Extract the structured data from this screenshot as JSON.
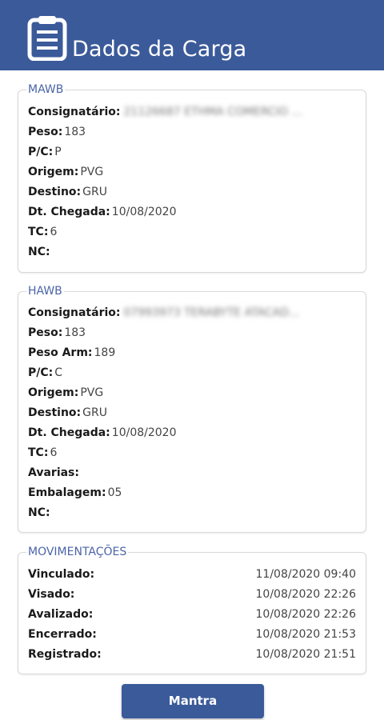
{
  "header": {
    "title": "Dados da Carga"
  },
  "mawb": {
    "legend": "MAWB",
    "rows": [
      {
        "label": "Consignatário:",
        "value": "21126687 ETHMA COMERCIO ..."
      },
      {
        "label": "Peso:",
        "value": "183"
      },
      {
        "label": "P/C:",
        "value": "P"
      },
      {
        "label": "Origem:",
        "value": "PVG"
      },
      {
        "label": "Destino:",
        "value": "GRU"
      },
      {
        "label": "Dt. Chegada:",
        "value": "10/08/2020"
      },
      {
        "label": "TC:",
        "value": "6"
      },
      {
        "label": "NC:",
        "value": ""
      }
    ]
  },
  "hawb": {
    "legend": "HAWB",
    "rows": [
      {
        "label": "Consignatário:",
        "value": "07993973 TERABYTE ATACAD..."
      },
      {
        "label": "Peso:",
        "value": "183"
      },
      {
        "label": "Peso Arm:",
        "value": "189"
      },
      {
        "label": "P/C:",
        "value": "C"
      },
      {
        "label": "Origem:",
        "value": "PVG"
      },
      {
        "label": "Destino:",
        "value": "GRU"
      },
      {
        "label": "Dt. Chegada:",
        "value": "10/08/2020"
      },
      {
        "label": "TC:",
        "value": "6"
      },
      {
        "label": "Avarias:",
        "value": ""
      },
      {
        "label": "Embalagem:",
        "value": "05"
      },
      {
        "label": "NC:",
        "value": ""
      }
    ]
  },
  "movimentacoes": {
    "legend": "MOVIMENTAÇÕES",
    "rows": [
      {
        "label": "Vinculado:",
        "value": "11/08/2020 09:40"
      },
      {
        "label": "Visado:",
        "value": "10/08/2020 22:26"
      },
      {
        "label": "Avalizado:",
        "value": "10/08/2020 22:26"
      },
      {
        "label": "Encerrado:",
        "value": "10/08/2020 21:53"
      },
      {
        "label": "Registrado:",
        "value": "10/08/2020 21:51"
      }
    ]
  },
  "actions": {
    "mantra_label": "Mantra"
  },
  "icons": {
    "header": "clipboard-list-icon"
  },
  "colors": {
    "primary": "#3b5a9a",
    "legend": "#4b64a8"
  }
}
